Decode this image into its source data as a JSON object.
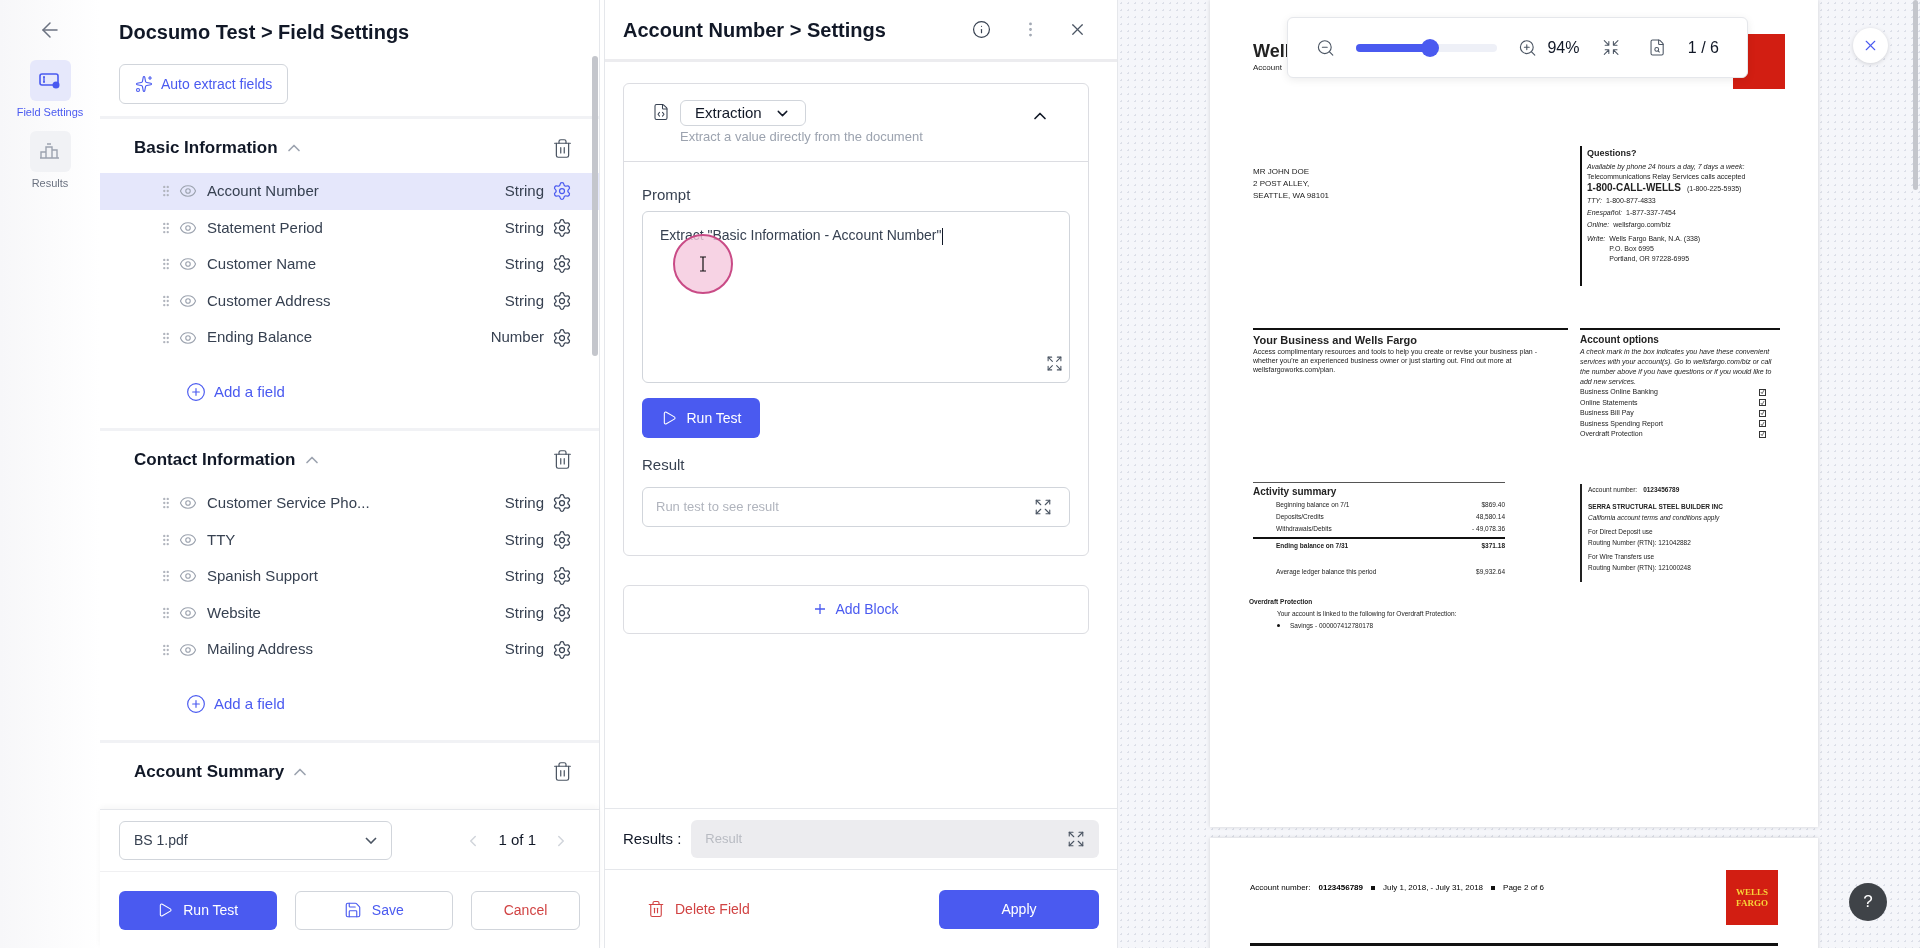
{
  "rail": {
    "items": [
      {
        "label": "Field Settings",
        "kind": "fields",
        "selected": true
      },
      {
        "label": "Results",
        "kind": "results",
        "selected": false
      }
    ]
  },
  "left": {
    "title": "Docsumo Test > Field Settings",
    "auto_extract": "Auto extract fields",
    "sections": [
      {
        "title": "Basic Information",
        "expanded": true,
        "add_label": "Add a field",
        "fields": [
          {
            "name": "Account Number",
            "type": "String",
            "selected": true
          },
          {
            "name": "Statement Period",
            "type": "String",
            "selected": false
          },
          {
            "name": "Customer Name",
            "type": "String",
            "selected": false
          },
          {
            "name": "Customer Address",
            "type": "String",
            "selected": false
          },
          {
            "name": "Ending Balance",
            "type": "Number",
            "selected": false
          }
        ]
      },
      {
        "title": "Contact Information",
        "expanded": true,
        "add_label": "Add a field",
        "fields": [
          {
            "name": "Customer Service Pho...",
            "type": "String",
            "selected": false
          },
          {
            "name": "TTY",
            "type": "String",
            "selected": false
          },
          {
            "name": "Spanish Support",
            "type": "String",
            "selected": false
          },
          {
            "name": "Website",
            "type": "String",
            "selected": false
          },
          {
            "name": "Mailing Address",
            "type": "String",
            "selected": false
          }
        ]
      },
      {
        "title": "Account Summary",
        "expanded": true
      }
    ],
    "file": "BS 1.pdf",
    "pager": "1 of 1",
    "run": "Run Test",
    "save": "Save",
    "cancel": "Cancel"
  },
  "settings": {
    "title": "Account Number > Settings",
    "block": {
      "type": "Extraction",
      "description": "Extract a value directly from the document",
      "expanded": true,
      "prompt_label": "Prompt",
      "prompt_value": "Extract \"Basic Information - Account Number\"",
      "run": "Run Test",
      "result_label": "Result",
      "result_placeholder": "Run test to see result"
    },
    "add_block": "Add Block",
    "results_label": "Results :",
    "results_placeholder": "Result",
    "delete": "Delete Field",
    "apply": "Apply"
  },
  "viewer": {
    "zoom_label": "94%",
    "level": 0.52,
    "page_label": "1 / 6",
    "help": "?",
    "page1": {
      "header_title": "Well",
      "header_sub": "Account",
      "address": [
        "MR JOHN DOE",
        "2 POST ALLEY,",
        "SEATTLE, WA 98101"
      ],
      "questions": {
        "title": "Questions?",
        "intro": "Available by phone 24 hours a day, 7 days a week:",
        "relay": "Telecommunications Relay Services calls accepted",
        "phone": "1-800-CALL-WELLS",
        "phone_alt": "(1-800-225-5935)",
        "lines": [
          {
            "label": "TTY:",
            "value": "1-800-877-4833"
          },
          {
            "label": "Enespañol:",
            "value": "1-877-337-7454"
          },
          {
            "label": "Online:",
            "value": "wellsfargo.com/biz"
          }
        ],
        "write_label": "Write:",
        "write_lines": [
          "Wells Fargo Bank, N.A. (338)",
          "P.O. Box 6995",
          "Portland, OR 97228-6995"
        ]
      },
      "business": {
        "title": "Your Business and Wells Fargo",
        "text": "Access complimentary resources and tools to help you create or revise your business plan - whether you're an experienced business owner or just starting out. Find out more at wellsfargoworks.com/plan."
      },
      "options": {
        "title": "Account options",
        "text": "A check mark in the box indicates you have these convenient services with your account(s).  Go to wellsfargo.com/biz or call the number above if you have questions or if you would like to add new services.",
        "items": [
          {
            "label": "Business Online Banking",
            "checked": true
          },
          {
            "label": "Online Statements",
            "checked": true
          },
          {
            "label": "Business Bill Pay",
            "checked": true
          },
          {
            "label": "Business Spending Report",
            "checked": true
          },
          {
            "label": "Overdraft Protection",
            "checked": true
          }
        ]
      },
      "activity": {
        "title": "Activity summary",
        "rows": [
          {
            "kind": "row",
            "label": "Beginning balance on 7/1",
            "value": "$869.40"
          },
          {
            "kind": "row",
            "label": "Deposits/Credits",
            "value": "48,580.14"
          },
          {
            "kind": "row",
            "label": "Withdrawals/Debits",
            "value": "- 49,078.36"
          },
          {
            "kind": "total",
            "label": "Ending balance on 7/31",
            "value": "$371.18"
          },
          {
            "kind": "average",
            "label": "Average ledger balance this period",
            "value": "$9,932.64"
          }
        ]
      },
      "account": {
        "label": "Account number:",
        "number": "0123456789",
        "company": "SERRA STRUCTURAL STEEL BUILDER INC",
        "terms": "California account terms and conditions apply",
        "lines": [
          "For Direct Deposit use",
          "Routing Number (RTN):  121042882",
          "For Wire Transfers use",
          "Routing Number (RTN):  121000248"
        ]
      },
      "overdraft": {
        "title": "Overdraft Protection",
        "text": "Your account is linked to the following for Overdraft Protection:",
        "bullet": "Savings  -  000007412780178"
      }
    },
    "page2": {
      "label": "Account number:",
      "number": "0123456789",
      "period": "July 1, 2018, - July 31, 2018",
      "page": "Page 2 of 6",
      "logo": [
        "WELLS",
        "FARGO"
      ]
    }
  }
}
